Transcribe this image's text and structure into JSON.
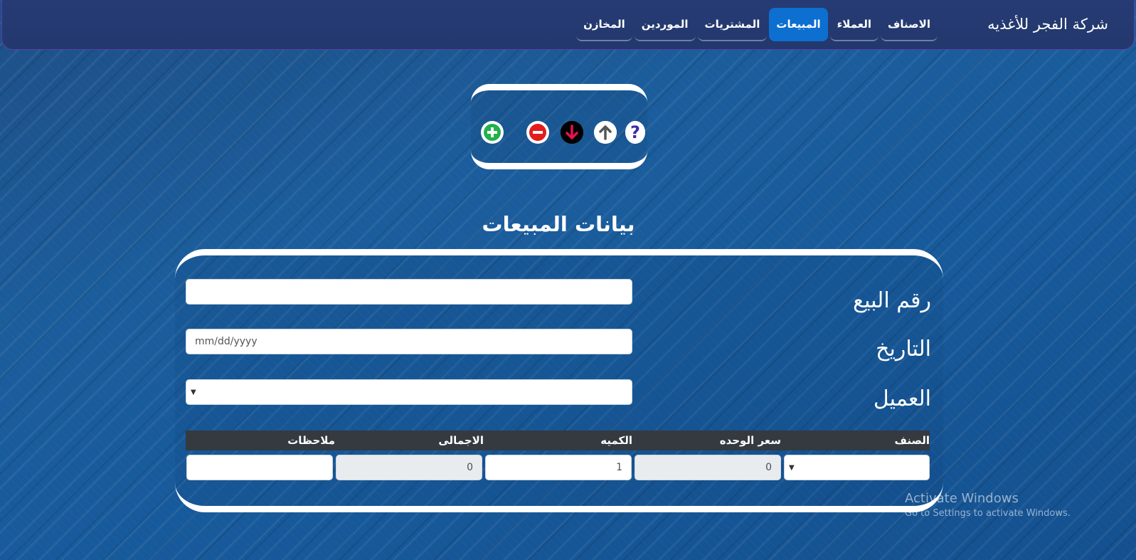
{
  "brand": "شركة الفجر للأغذيه",
  "nav": [
    {
      "label": "الاصناف",
      "active": false
    },
    {
      "label": "العملاء",
      "active": false
    },
    {
      "label": "المبيعات",
      "active": true
    },
    {
      "label": "المشتريات",
      "active": false
    },
    {
      "label": "الموردين",
      "active": false
    },
    {
      "label": "المخازن",
      "active": false
    }
  ],
  "toolbar": {
    "icons": [
      "add-icon",
      "remove-icon",
      "arrow-down-icon",
      "arrow-up-icon",
      "help-icon"
    ],
    "colors": {
      "add": "#22b14c",
      "remove": "#e31c1c",
      "down": "#e8114f",
      "up": "#555555",
      "help": "#3b2ea8"
    }
  },
  "section_title": "بيانات المبيعات",
  "form": {
    "sale_number_label": "رقم البيع",
    "sale_number_value": "",
    "date_label": "التاريخ",
    "date_placeholder": "mm/dd/yyyy",
    "customer_label": "العميل",
    "customer_value": ""
  },
  "table": {
    "headers": [
      "الصنف",
      "سعر الوحده",
      "الكميه",
      "الاجمالى",
      "ملاحظات"
    ],
    "row": {
      "item": "",
      "unit_price": "0",
      "quantity": "1",
      "total": "0",
      "notes": ""
    }
  },
  "watermark": {
    "line1": "Activate Windows",
    "line2": "Go to Settings to activate Windows."
  }
}
